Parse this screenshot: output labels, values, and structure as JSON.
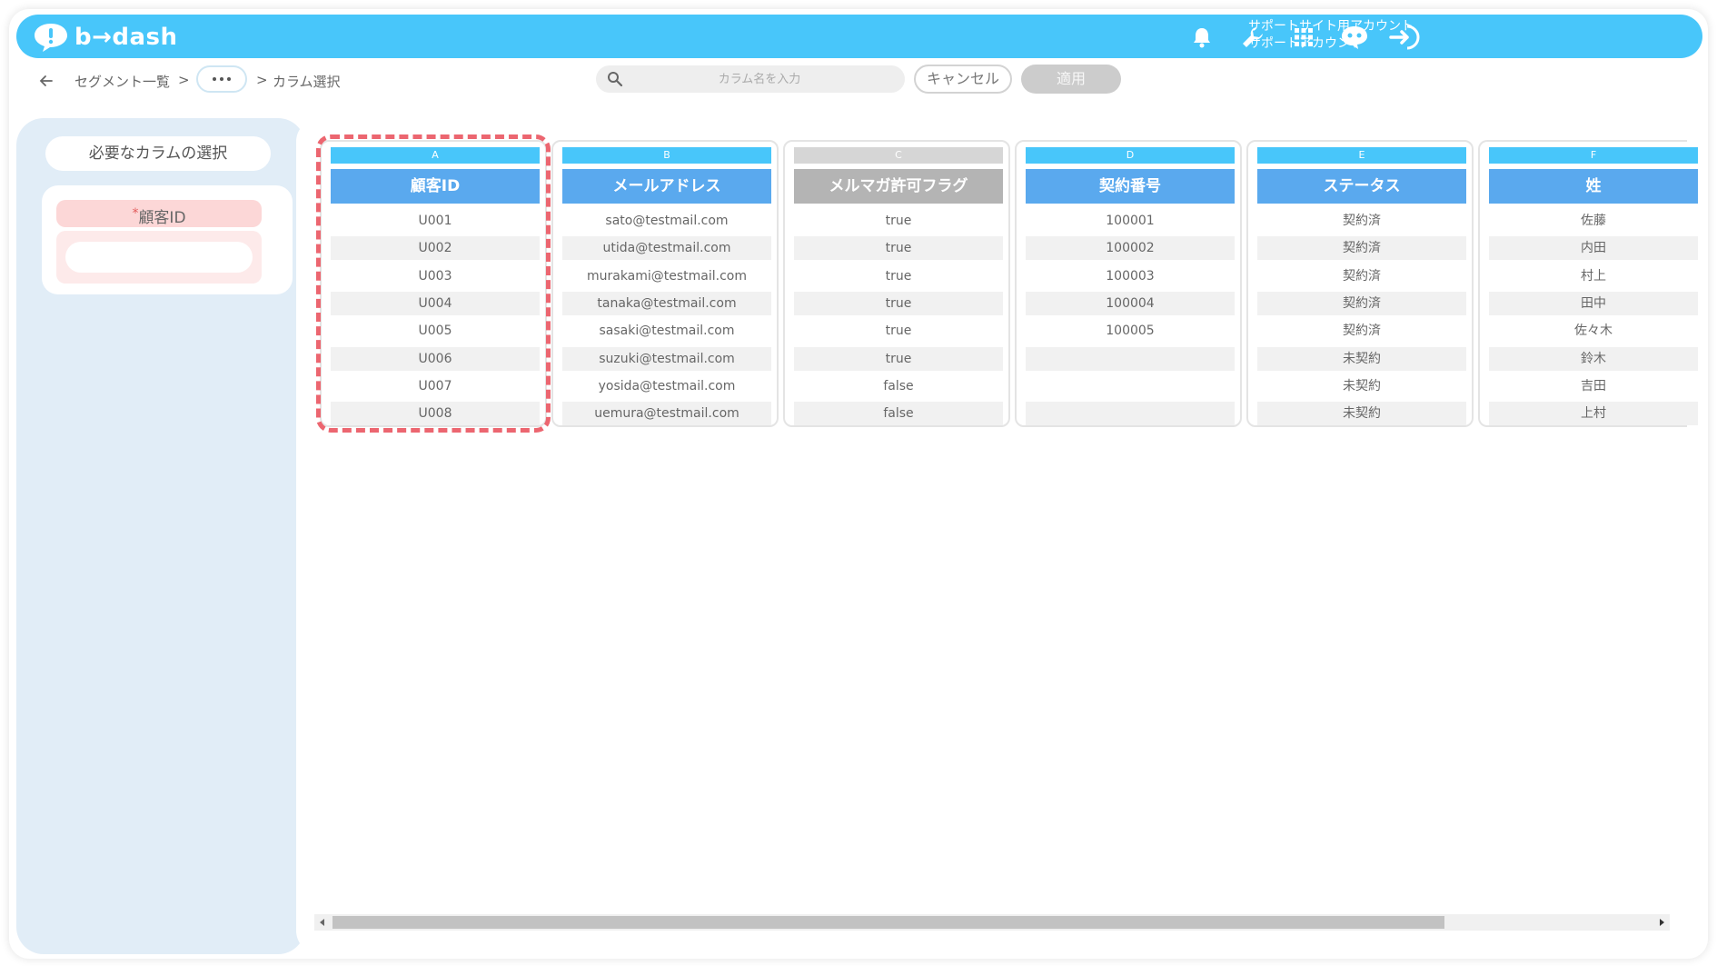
{
  "header": {
    "logo_text": "b→dash",
    "account_line1": "サポートサイト用アカウント",
    "account_line2": "サポートアカウント",
    "icons": [
      "bell-icon",
      "wrench-icon",
      "grid-icon",
      "chat-bot-icon",
      "logout-icon"
    ],
    "accent_color": "#48c6fa"
  },
  "breadcrumb": {
    "segment_list": "セグメント一覧",
    "sep1": ">",
    "sep2": ">",
    "current": "カラム選択"
  },
  "search": {
    "placeholder": "カラム名を入力",
    "value": ""
  },
  "actions": {
    "cancel_label": "キャンセル",
    "apply_label": "適用"
  },
  "left_panel": {
    "title": "必要なカラムの選択",
    "required_label": "顧客ID",
    "required_mark": "*"
  },
  "columns": [
    {
      "letter": "A",
      "title": "顧客ID",
      "enabled": true,
      "cells": [
        "U001",
        "U002",
        "U003",
        "U004",
        "U005",
        "U006",
        "U007",
        "U008"
      ]
    },
    {
      "letter": "B",
      "title": "メールアドレス",
      "enabled": true,
      "cells": [
        "sato@testmail.com",
        "utida@testmail.com",
        "murakami@testmail.com",
        "tanaka@testmail.com",
        "sasaki@testmail.com",
        "suzuki@testmail.com",
        "yosida@testmail.com",
        "uemura@testmail.com"
      ]
    },
    {
      "letter": "C",
      "title": "メルマガ許可フラグ",
      "enabled": false,
      "cells": [
        "true",
        "true",
        "true",
        "true",
        "true",
        "true",
        "false",
        "false"
      ]
    },
    {
      "letter": "D",
      "title": "契約番号",
      "enabled": true,
      "cells": [
        "100001",
        "100002",
        "100003",
        "100004",
        "100005",
        "",
        "",
        ""
      ]
    },
    {
      "letter": "E",
      "title": "ステータス",
      "enabled": true,
      "cells": [
        "契約済",
        "契約済",
        "契約済",
        "契約済",
        "契約済",
        "未契約",
        "未契約",
        "未契約"
      ]
    },
    {
      "letter": "F",
      "title": "姓",
      "enabled": true,
      "cells": [
        "佐藤",
        "内田",
        "村上",
        "田中",
        "佐々木",
        "鈴木",
        "吉田",
        "上村"
      ]
    }
  ]
}
